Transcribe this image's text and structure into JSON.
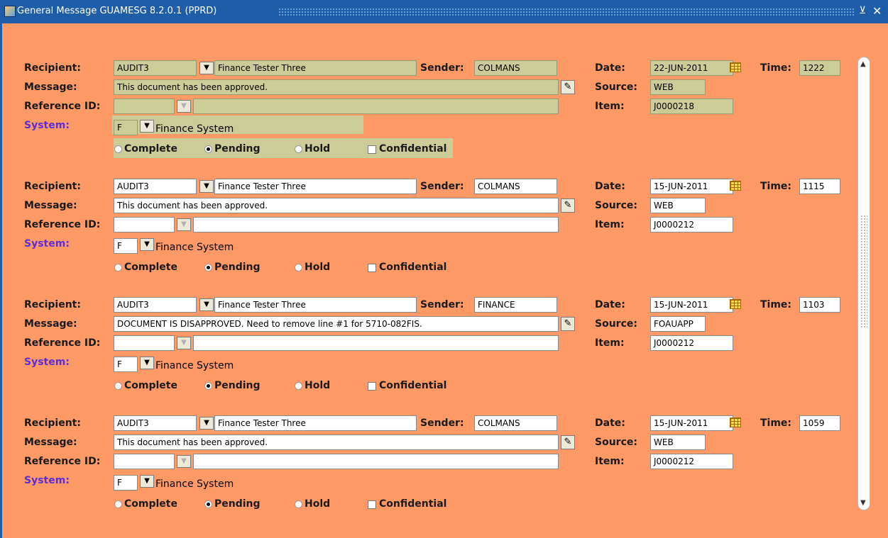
{
  "window": {
    "title": "General Message  GUAMESG  8.2.0.1  (PPRD)",
    "minimize_glyph": "⊻",
    "close_glyph": "✕"
  },
  "labels": {
    "recipient": "Recipient:",
    "message": "Message:",
    "reference_id": "Reference ID:",
    "system": "System:",
    "sender": "Sender:",
    "date": "Date:",
    "time": "Time:",
    "source": "Source:",
    "item": "Item:",
    "complete": "Complete",
    "pending": "Pending",
    "hold": "Hold",
    "confidential": "Confidential"
  },
  "icons": {
    "dropdown": "▼",
    "edit": "✎",
    "scroll_up": "▲",
    "scroll_down": "▼"
  },
  "records": [
    {
      "recipient_id": "AUDIT3",
      "recipient_name": "Finance Tester Three",
      "sender": "COLMANS",
      "date": "22-JUN-2011",
      "time": "1222",
      "message": "This document has been approved.",
      "source": "WEB",
      "reference_id": "",
      "reference_desc": "",
      "item": "J0000218",
      "system_code": "F",
      "system_name": "Finance System",
      "status": "Pending",
      "confidential": false
    },
    {
      "recipient_id": "AUDIT3",
      "recipient_name": "Finance Tester Three",
      "sender": "COLMANS",
      "date": "15-JUN-2011",
      "time": "1115",
      "message": "This document has been approved.",
      "source": "WEB",
      "reference_id": "",
      "reference_desc": "",
      "item": "J0000212",
      "system_code": "F",
      "system_name": "Finance System",
      "status": "Pending",
      "confidential": false
    },
    {
      "recipient_id": "AUDIT3",
      "recipient_name": "Finance Tester Three",
      "sender": "FINANCE",
      "date": "15-JUN-2011",
      "time": "1103",
      "message": "DOCUMENT IS DISAPPROVED.  Need to remove line #1 for 5710-082FIS.",
      "source": "FOAUAPP",
      "reference_id": "",
      "reference_desc": "",
      "item": "J0000212",
      "system_code": "F",
      "system_name": "Finance System",
      "status": "Pending",
      "confidential": false
    },
    {
      "recipient_id": "AUDIT3",
      "recipient_name": "Finance Tester Three",
      "sender": "COLMANS",
      "date": "15-JUN-2011",
      "time": "1059",
      "message": "This document has been approved.",
      "source": "WEB",
      "reference_id": "",
      "reference_desc": "",
      "item": "J0000212",
      "system_code": "F",
      "system_name": "Finance System",
      "status": "Pending",
      "confidential": false
    }
  ],
  "colors": {
    "canvas": "#FF9966",
    "current_record_field": "#CCCC99",
    "titlebar": "#1E5EA8",
    "system_label": "#5B2ED8"
  }
}
